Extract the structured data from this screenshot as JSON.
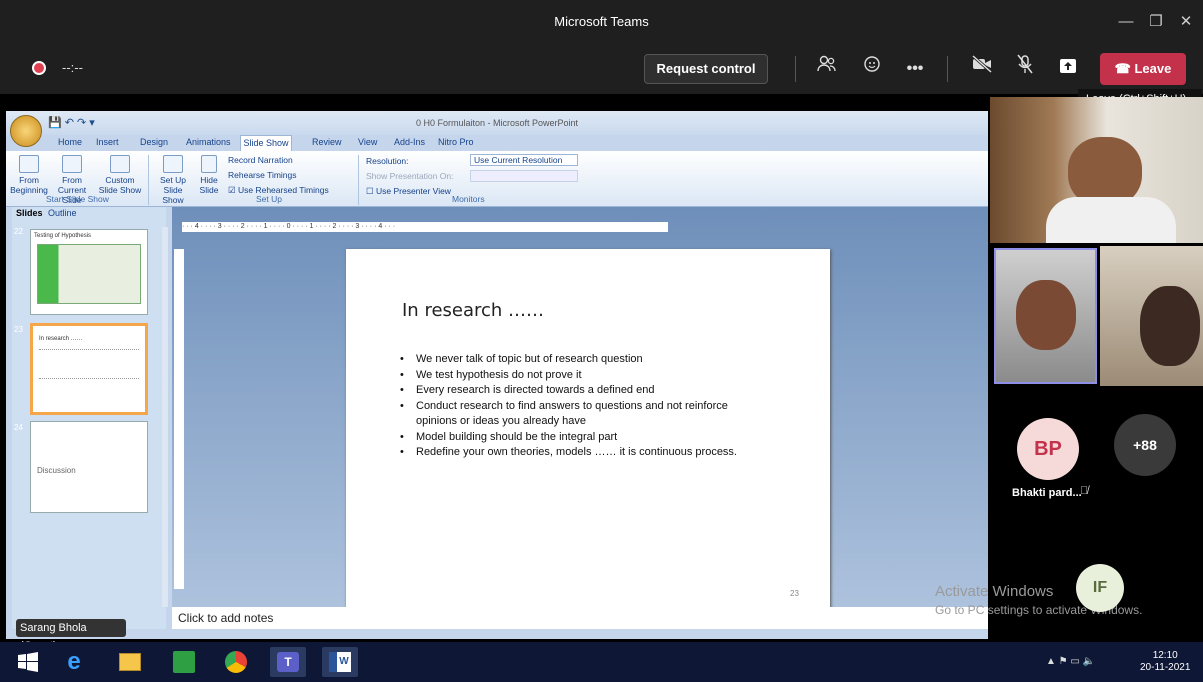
{
  "window": {
    "title": "Microsoft Teams",
    "minimize": "—",
    "maximize": "❐",
    "close": "✕"
  },
  "meeting": {
    "timer": "--:--",
    "request_control": "Request control",
    "leave": "Leave",
    "leave_tooltip": "Leave (Ctrl+Shift+H)"
  },
  "powerpoint": {
    "title": "0 H0 Formulaiton - Microsoft PowerPoint",
    "tabs": [
      "Home",
      "Insert",
      "Design",
      "Animations",
      "Slide Show",
      "Review",
      "View",
      "Add-Ins",
      "Nitro Pro"
    ],
    "active_tab": "Slide Show",
    "ribbon": {
      "from_beginning": "From Beginning",
      "from_current": "From Current Slide",
      "custom": "Custom Slide Show",
      "group_start": "Start Slide Show",
      "set_up": "Set Up Slide Show",
      "hide": "Hide Slide",
      "record": "Record Narration",
      "rehearse": "Rehearse Timings",
      "use_timings": "Use Rehearsed Timings",
      "group_setup": "Set Up",
      "resolution_label": "Resolution:",
      "resolution_value": "Use Current Resolution",
      "show_on": "Show Presentation On:",
      "presenter": "Use Presenter View",
      "group_monitors": "Monitors"
    },
    "panel_tabs": [
      "Slides",
      "Outline"
    ],
    "thumbnails": [
      {
        "num": "22",
        "title": "Testing of Hypothesis"
      },
      {
        "num": "23",
        "title": "In research ……"
      },
      {
        "num": "24",
        "title": "Discussion"
      }
    ],
    "slide": {
      "title": "In research ……",
      "bullets": [
        "We never talk of topic but of research question",
        "We test hypothesis do not prove it",
        "Every research is directed towards a defined end",
        "Conduct research to find answers to questions and not reinforce opinions or ideas you already have",
        "Model building should be the integral part",
        "Redefine your own theories, models …… it is continuous process."
      ],
      "number": "23"
    },
    "notes_placeholder": "Click to add notes",
    "presenter_name": "Sarang Bhola (Guest)"
  },
  "participants": {
    "bp_initials": "BP",
    "bp_name": "Bhakti pard...",
    "overflow": "+88",
    "if_initials": "IF"
  },
  "watermark": {
    "line1": "Activate Windows",
    "line2": "Go to PC settings to activate Windows."
  },
  "taskbar": {
    "time": "12:10",
    "date": "20-11-2021"
  },
  "colors": {
    "leave": "#c4314b",
    "bp_avatar": "#f6dada",
    "bp_text": "#c4314b"
  }
}
